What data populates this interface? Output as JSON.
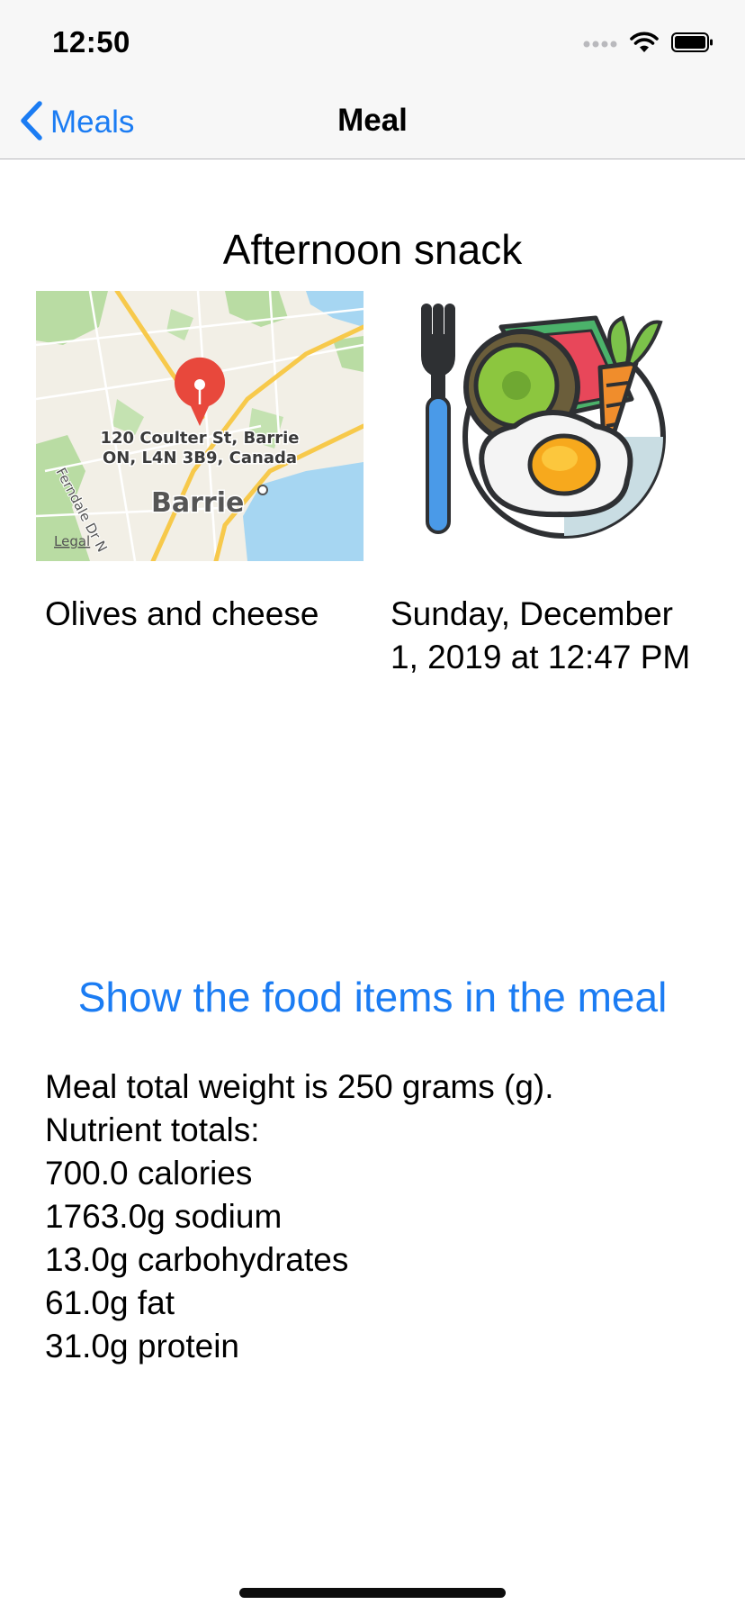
{
  "status_bar": {
    "time": "12:50",
    "icons": [
      "cellular-dots-icon",
      "wifi-icon",
      "battery-icon"
    ]
  },
  "nav": {
    "back_label": "Meals",
    "title": "Meal"
  },
  "meal": {
    "title": "Afternoon snack",
    "description": "Olives and cheese",
    "datetime": "Sunday, December 1, 2019 at 12:47 PM"
  },
  "map": {
    "address_line1": "120 Coulter St, Barrie",
    "address_line2": "ON, L4N 3B9, Canada",
    "city_label": "Barrie",
    "street_label": "Ferndale Dr N",
    "legal_label": "Legal"
  },
  "actions": {
    "show_items_label": "Show the food items in the meal"
  },
  "nutrition": {
    "weight_line": "Meal total weight is 250 grams (g).",
    "header": "Nutrient totals:",
    "calories": "700.0 calories",
    "sodium": "1763.0g sodium",
    "carbohydrates": "13.0g carbohydrates",
    "fat": "61.0g fat",
    "protein": "31.0g protein"
  },
  "colors": {
    "accent": "#1b7cf3",
    "map_pin": "#e8483c",
    "water": "#a6d6f2",
    "park": "#b9dca3",
    "road_major": "#f7c94b"
  }
}
